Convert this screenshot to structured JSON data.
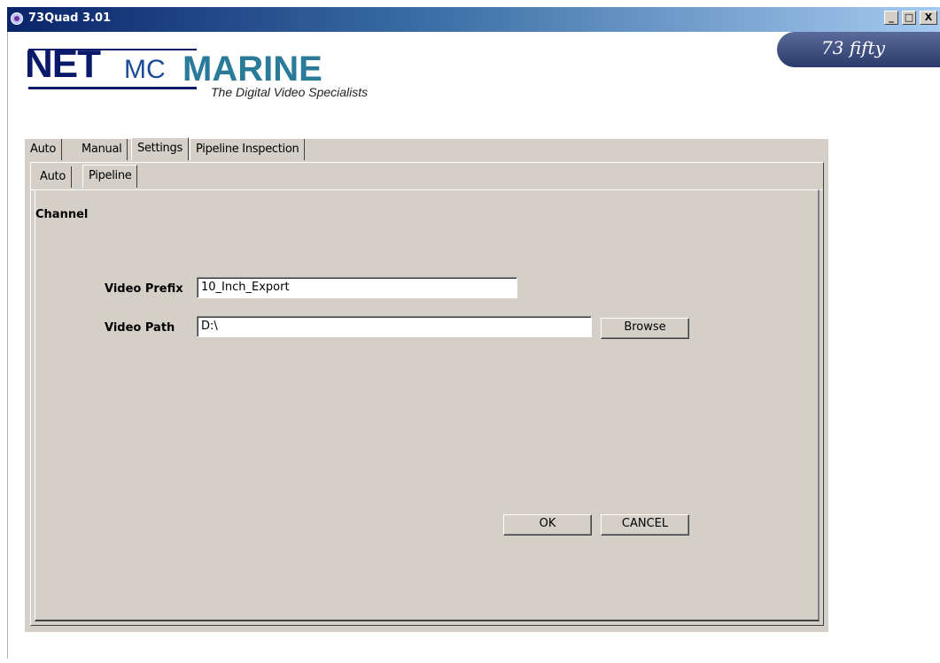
{
  "window": {
    "title": "73Quad 3.01",
    "controls": {
      "minimize": "_",
      "maximize": "□",
      "close": "X"
    }
  },
  "logo": {
    "net": "NET",
    "mc": "MC",
    "marine": "MARINE",
    "tagline": "The Digital Video Specialists"
  },
  "brand_badge": "73 fifty",
  "outer_tabs": [
    {
      "label": "Auto"
    },
    {
      "label": "Manual"
    },
    {
      "label": "Settings",
      "active": true
    },
    {
      "label": "Pipeline Inspection"
    }
  ],
  "inner_tabs": [
    {
      "label": "Auto"
    },
    {
      "label": "Pipeline",
      "active": true
    }
  ],
  "content": {
    "section_label": "Channel",
    "video_prefix": {
      "label": "Video Prefix",
      "value": "10_Inch_Export"
    },
    "video_path": {
      "label": "Video Path",
      "value": "D:\\"
    },
    "browse_label": "Browse",
    "ok_label": "OK",
    "cancel_label": "CANCEL"
  }
}
